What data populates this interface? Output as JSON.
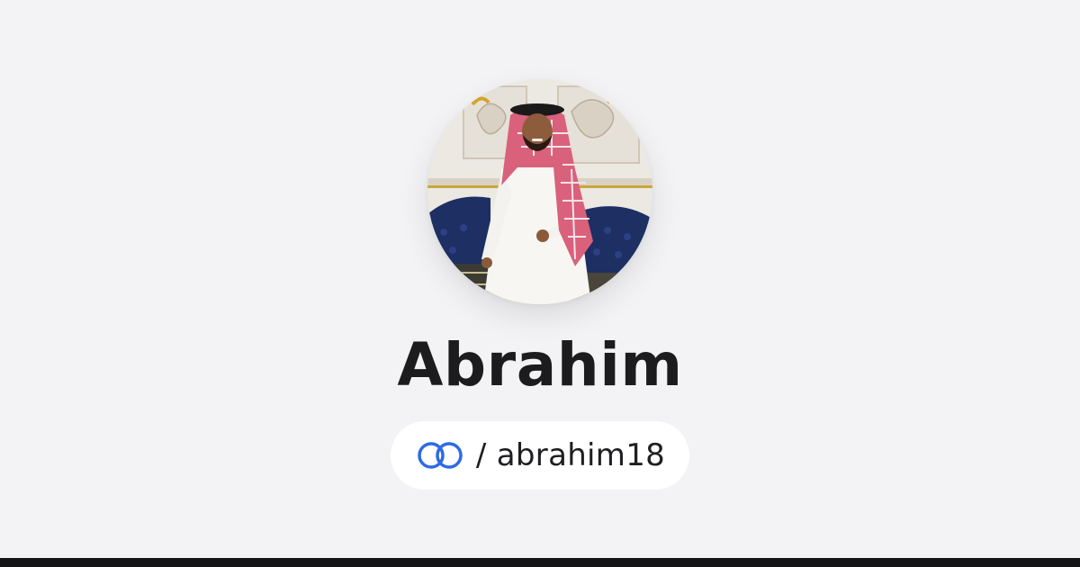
{
  "profile": {
    "name": "Abrahim",
    "handle_separator": "/",
    "handle": "abrahim18",
    "avatar": "profile-photo",
    "link_icon": "linked-rings-icon"
  },
  "colors": {
    "background": "#f3f3f5",
    "pill": "#ffffff",
    "name_text": "#1c1c1e",
    "accent_blue": "#2d6be4",
    "bottom_bar": "#141416"
  }
}
